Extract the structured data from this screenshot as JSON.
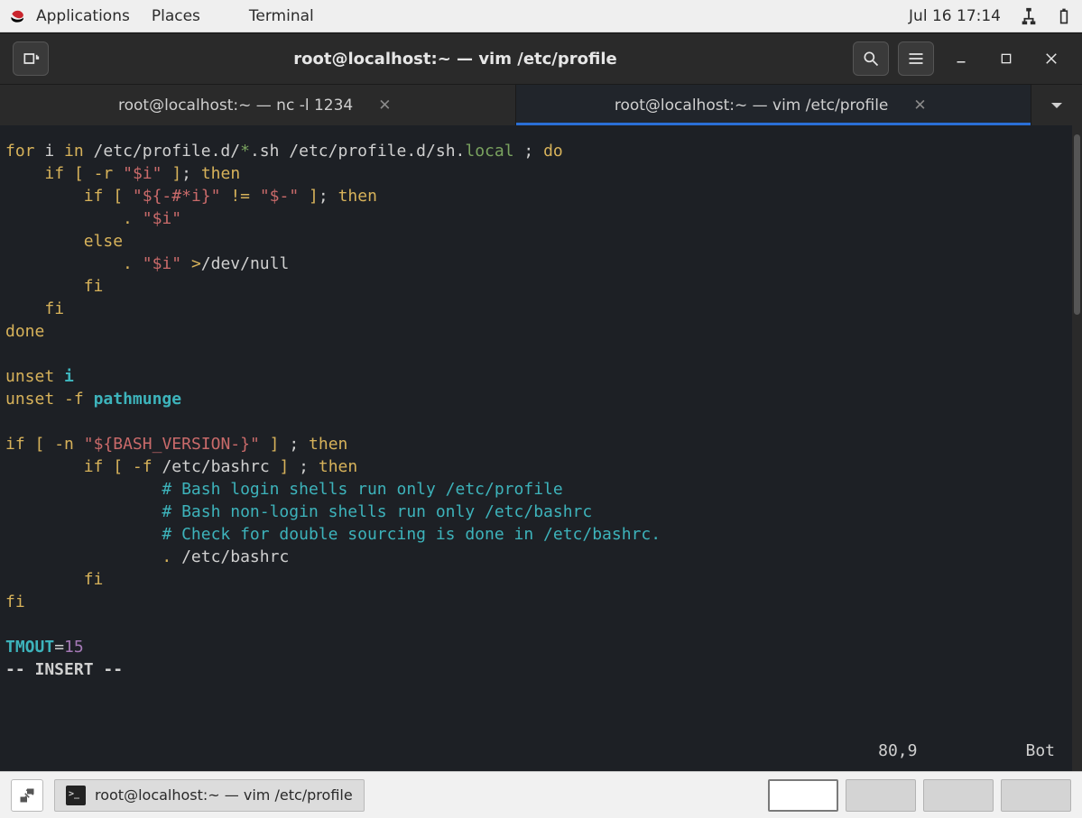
{
  "gnome": {
    "app": "Applications",
    "places": "Places",
    "active_app": "Terminal",
    "clock": "Jul 16  17:14"
  },
  "window": {
    "title": "root@localhost:~ — vim /etc/profile",
    "tabs": [
      {
        "label": "root@localhost:~ — nc -l 1234",
        "active": false
      },
      {
        "label": "root@localhost:~ — vim /etc/profile",
        "active": true
      }
    ]
  },
  "vim": {
    "lines": [
      [
        {
          "c": "c-yellow",
          "t": "for"
        },
        {
          "c": "c-white",
          "t": " i "
        },
        {
          "c": "c-yellow",
          "t": "in"
        },
        {
          "c": "c-white",
          "t": " /etc/profile.d/"
        },
        {
          "c": "c-green",
          "t": "*"
        },
        {
          "c": "c-white",
          "t": ".sh /etc/profile.d/sh."
        },
        {
          "c": "c-green",
          "t": "local"
        },
        {
          "c": "c-white",
          "t": " ; "
        },
        {
          "c": "c-yellow",
          "t": "do"
        }
      ],
      [
        {
          "c": "c-white",
          "t": "    "
        },
        {
          "c": "c-yellow",
          "t": "if"
        },
        {
          "c": "c-white",
          "t": " "
        },
        {
          "c": "c-yellow",
          "t": "["
        },
        {
          "c": "c-white",
          "t": " "
        },
        {
          "c": "c-yellow",
          "t": "-r"
        },
        {
          "c": "c-white",
          "t": " "
        },
        {
          "c": "c-red",
          "t": "\"$i\""
        },
        {
          "c": "c-white",
          "t": " "
        },
        {
          "c": "c-yellow",
          "t": "]"
        },
        {
          "c": "c-white",
          "t": "; "
        },
        {
          "c": "c-yellow",
          "t": "then"
        }
      ],
      [
        {
          "c": "c-white",
          "t": "        "
        },
        {
          "c": "c-yellow",
          "t": "if"
        },
        {
          "c": "c-white",
          "t": " "
        },
        {
          "c": "c-yellow",
          "t": "["
        },
        {
          "c": "c-white",
          "t": " "
        },
        {
          "c": "c-red",
          "t": "\"${-#*i}\""
        },
        {
          "c": "c-white",
          "t": " "
        },
        {
          "c": "c-yellow",
          "t": "!="
        },
        {
          "c": "c-white",
          "t": " "
        },
        {
          "c": "c-red",
          "t": "\"$-\""
        },
        {
          "c": "c-white",
          "t": " "
        },
        {
          "c": "c-yellow",
          "t": "]"
        },
        {
          "c": "c-white",
          "t": "; "
        },
        {
          "c": "c-yellow",
          "t": "then"
        }
      ],
      [
        {
          "c": "c-white",
          "t": "            "
        },
        {
          "c": "c-yellow",
          "t": "."
        },
        {
          "c": "c-white",
          "t": " "
        },
        {
          "c": "c-red",
          "t": "\"$i\""
        }
      ],
      [
        {
          "c": "c-white",
          "t": "        "
        },
        {
          "c": "c-yellow",
          "t": "else"
        }
      ],
      [
        {
          "c": "c-white",
          "t": "            "
        },
        {
          "c": "c-yellow",
          "t": "."
        },
        {
          "c": "c-white",
          "t": " "
        },
        {
          "c": "c-red",
          "t": "\"$i\""
        },
        {
          "c": "c-white",
          "t": " "
        },
        {
          "c": "c-yellow",
          "t": ">"
        },
        {
          "c": "c-white",
          "t": "/dev/null"
        }
      ],
      [
        {
          "c": "c-white",
          "t": "        "
        },
        {
          "c": "c-yellow",
          "t": "fi"
        }
      ],
      [
        {
          "c": "c-white",
          "t": "    "
        },
        {
          "c": "c-yellow",
          "t": "fi"
        }
      ],
      [
        {
          "c": "c-yellow",
          "t": "done"
        }
      ],
      [
        {
          "c": "c-white",
          "t": " "
        }
      ],
      [
        {
          "c": "c-yellow",
          "t": "unset"
        },
        {
          "c": "c-white",
          "t": " "
        },
        {
          "c": "c-cyan-b",
          "t": "i"
        }
      ],
      [
        {
          "c": "c-yellow",
          "t": "unset"
        },
        {
          "c": "c-white",
          "t": " "
        },
        {
          "c": "c-yellow",
          "t": "-f"
        },
        {
          "c": "c-white",
          "t": " "
        },
        {
          "c": "c-cyan-b",
          "t": "pathmunge"
        }
      ],
      [
        {
          "c": "c-white",
          "t": " "
        }
      ],
      [
        {
          "c": "c-yellow",
          "t": "if"
        },
        {
          "c": "c-white",
          "t": " "
        },
        {
          "c": "c-yellow",
          "t": "["
        },
        {
          "c": "c-white",
          "t": " "
        },
        {
          "c": "c-yellow",
          "t": "-n"
        },
        {
          "c": "c-white",
          "t": " "
        },
        {
          "c": "c-red",
          "t": "\"${BASH_VERSION-}\""
        },
        {
          "c": "c-white",
          "t": " "
        },
        {
          "c": "c-yellow",
          "t": "]"
        },
        {
          "c": "c-white",
          "t": " ; "
        },
        {
          "c": "c-yellow",
          "t": "then"
        }
      ],
      [
        {
          "c": "c-white",
          "t": "        "
        },
        {
          "c": "c-yellow",
          "t": "if"
        },
        {
          "c": "c-white",
          "t": " "
        },
        {
          "c": "c-yellow",
          "t": "["
        },
        {
          "c": "c-white",
          "t": " "
        },
        {
          "c": "c-yellow",
          "t": "-f"
        },
        {
          "c": "c-white",
          "t": " /etc/bashrc "
        },
        {
          "c": "c-yellow",
          "t": "]"
        },
        {
          "c": "c-white",
          "t": " ; "
        },
        {
          "c": "c-yellow",
          "t": "then"
        }
      ],
      [
        {
          "c": "c-white",
          "t": "                "
        },
        {
          "c": "c-comment",
          "t": "# Bash login shells run only /etc/profile"
        }
      ],
      [
        {
          "c": "c-white",
          "t": "                "
        },
        {
          "c": "c-comment",
          "t": "# Bash non-login shells run only /etc/bashrc"
        }
      ],
      [
        {
          "c": "c-white",
          "t": "                "
        },
        {
          "c": "c-comment",
          "t": "# Check for double sourcing is done in /etc/bashrc."
        }
      ],
      [
        {
          "c": "c-white",
          "t": "                "
        },
        {
          "c": "c-yellow",
          "t": "."
        },
        {
          "c": "c-white",
          "t": " /etc/bashrc"
        }
      ],
      [
        {
          "c": "c-white",
          "t": "        "
        },
        {
          "c": "c-yellow",
          "t": "fi"
        }
      ],
      [
        {
          "c": "c-yellow",
          "t": "fi"
        }
      ],
      [
        {
          "c": "c-white",
          "t": " "
        }
      ],
      [
        {
          "c": "c-cyan-b",
          "t": "TMOUT"
        },
        {
          "c": "c-white",
          "t": "="
        },
        {
          "c": "c-purple",
          "t": "15"
        }
      ],
      [
        {
          "c": "c-white bold",
          "t": "-- INSERT --"
        }
      ]
    ],
    "status_pos": "80,9",
    "status_scroll": "Bot"
  },
  "taskbar": {
    "task_label": "root@localhost:~ — vim /etc/profile"
  }
}
